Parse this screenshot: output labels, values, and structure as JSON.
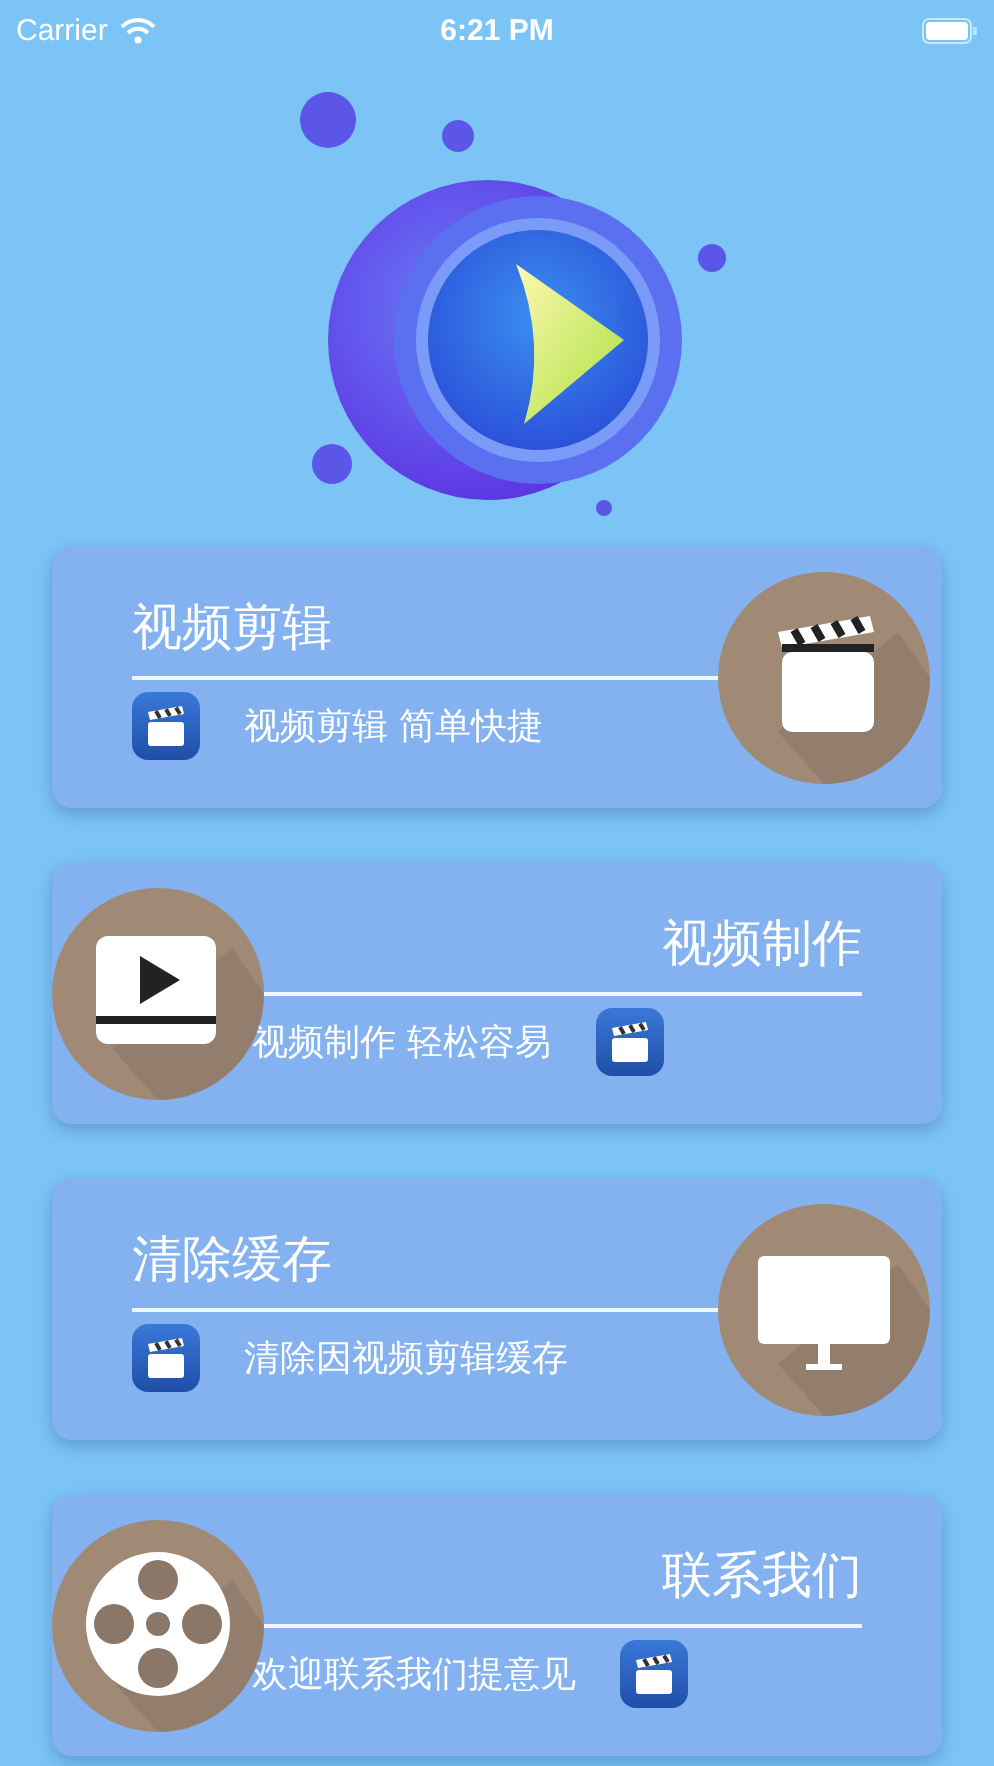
{
  "status_bar": {
    "carrier": "Carrier",
    "time": "6:21 PM"
  },
  "cards": [
    {
      "title": "视频剪辑",
      "subtitle": "视频剪辑 简单快捷"
    },
    {
      "title": "视频制作",
      "subtitle": "视频制作 轻松容易"
    },
    {
      "title": "清除缓存",
      "subtitle": "清除因视频剪辑缓存"
    },
    {
      "title": "联系我们",
      "subtitle": "欢迎联系我们提意见"
    }
  ]
}
